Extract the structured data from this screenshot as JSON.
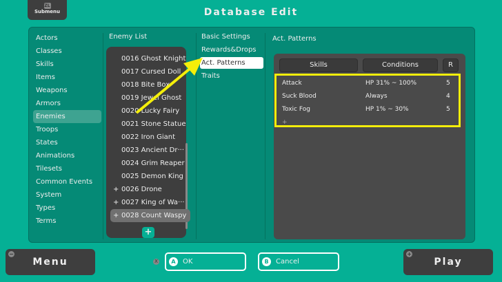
{
  "submenu": {
    "key": "ZL",
    "label": "Submenu"
  },
  "title": "Database Edit",
  "categories": [
    "Actors",
    "Classes",
    "Skills",
    "Items",
    "Weapons",
    "Armors",
    "Enemies",
    "Troops",
    "States",
    "Animations",
    "Tilesets",
    "Common Events",
    "System",
    "Types",
    "Terms"
  ],
  "selected_category": "Enemies",
  "enemy_list": {
    "title": "Enemy List",
    "items": [
      {
        "label": "0016 Ghost Knight",
        "plus": ""
      },
      {
        "label": "0017 Cursed Doll",
        "plus": ""
      },
      {
        "label": "0018 Bite Box",
        "plus": ""
      },
      {
        "label": "0019 Jewel Ghost",
        "plus": ""
      },
      {
        "label": "0020 Lucky Fairy",
        "plus": ""
      },
      {
        "label": "0021 Stone Statue",
        "plus": ""
      },
      {
        "label": "0022 Iron Giant",
        "plus": ""
      },
      {
        "label": "0023 Ancient Dr···",
        "plus": ""
      },
      {
        "label": "0024 Grim Reaper",
        "plus": ""
      },
      {
        "label": "0025 Demon King",
        "plus": ""
      },
      {
        "label": "0026 Drone",
        "plus": "+"
      },
      {
        "label": "0027 King of Wa···",
        "plus": "+"
      },
      {
        "label": "0028 Count Waspy",
        "plus": "+"
      }
    ],
    "add": "+"
  },
  "tabs": [
    "Basic Settings",
    "Rewards&Drops",
    "Act. Patterns",
    "Traits"
  ],
  "patterns": {
    "title": "Act. Patterns",
    "headers": [
      "Skills",
      "Conditions",
      "R"
    ],
    "rows": [
      {
        "skill": "Attack",
        "cond": "HP 31% ~ 100%",
        "r": "5"
      },
      {
        "skill": "Suck Blood",
        "cond": "Always",
        "r": "4"
      },
      {
        "skill": "Toxic Fog",
        "cond": "HP 1% ~ 30%",
        "r": "5"
      }
    ],
    "add": "+"
  },
  "bottom": {
    "menu": "Menu",
    "menu_key": "−",
    "x_key": "X",
    "ok_key": "A",
    "ok": "OK",
    "cancel_key": "B",
    "cancel": "Cancel",
    "play": "Play",
    "play_key": "+"
  },
  "colors": {
    "bg": "#05b095",
    "highlight": "#f4ee0a"
  }
}
